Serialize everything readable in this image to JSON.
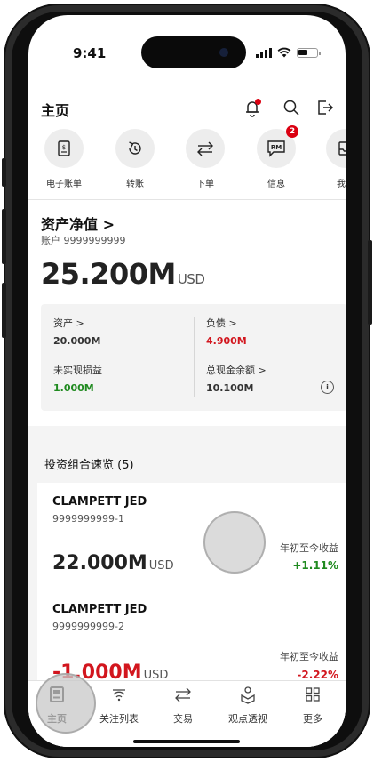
{
  "status_bar": {
    "time": "9:41"
  },
  "header": {
    "title": "主页"
  },
  "quick_actions": [
    {
      "label": "电子账单",
      "icon": "statement-icon"
    },
    {
      "label": "转账",
      "icon": "transfer-icon"
    },
    {
      "label": "下单",
      "icon": "order-icon"
    },
    {
      "label": "信息",
      "icon": "message-icon",
      "badge": "2"
    },
    {
      "label": "我的",
      "icon": "inbox-icon"
    }
  ],
  "net_worth": {
    "title": "资产净值 >",
    "account": "账户 9999999999",
    "amount": "25.200",
    "unit": "M",
    "currency": "USD"
  },
  "summary": {
    "assets_label": "资产 >",
    "assets_value": "20.000M",
    "liabilities_label": "负债 >",
    "liabilities_value": "4.900M",
    "unrealized_label": "未实现损益",
    "unrealized_value": "1.000M",
    "cash_label": "总现金余额 >",
    "cash_value": "10.100M",
    "info": "i"
  },
  "portfolio": {
    "title": "投资组合速览 (5)",
    "cards": [
      {
        "name": "CLAMPETT JED",
        "account": "9999999999-1",
        "amount": "22.000M",
        "currency": "USD",
        "ytd_label": "年初至今收益",
        "ytd_value": "+1.11%"
      },
      {
        "name": "CLAMPETT JED",
        "account": "9999999999-2",
        "amount": "-1.000M",
        "currency": "USD",
        "ytd_label": "年初至今收益",
        "ytd_value": "-2.22%"
      }
    ]
  },
  "tabs": [
    {
      "label": "主页",
      "icon": "home-icon"
    },
    {
      "label": "关注列表",
      "icon": "watchlist-icon"
    },
    {
      "label": "交易",
      "icon": "trade-icon"
    },
    {
      "label": "观点透视",
      "icon": "insights-icon"
    },
    {
      "label": "更多",
      "icon": "more-grid-icon"
    }
  ],
  "colors": {
    "accent": "#db0011",
    "positive": "#1f8a1f",
    "negative": "#d2161e"
  }
}
